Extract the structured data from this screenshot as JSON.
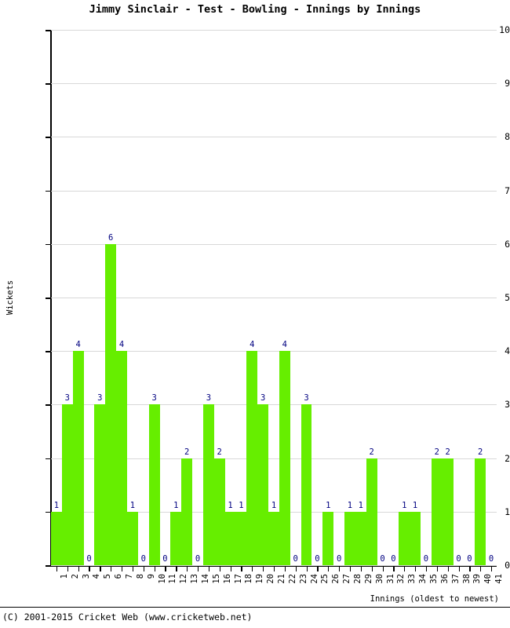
{
  "chart_data": {
    "type": "bar",
    "title": "Jimmy Sinclair - Test - Bowling - Innings by Innings",
    "xlabel": "Innings (oldest to newest)",
    "ylabel": "Wickets",
    "ylim": [
      0,
      10
    ],
    "ytick_labels": [
      "0",
      "1",
      "2",
      "3",
      "4",
      "5",
      "6",
      "7",
      "8",
      "9",
      "10"
    ],
    "grid": true,
    "legend": "none",
    "bar_color": "#66EE00",
    "label_color": "#000080",
    "categories": [
      "1",
      "2",
      "3",
      "4",
      "5",
      "6",
      "7",
      "8",
      "9",
      "10",
      "11",
      "12",
      "13",
      "14",
      "15",
      "16",
      "17",
      "18",
      "19",
      "20",
      "21",
      "22",
      "23",
      "24",
      "25",
      "26",
      "27",
      "28",
      "29",
      "30",
      "31",
      "32",
      "33",
      "34",
      "35",
      "36",
      "37",
      "38",
      "39",
      "40",
      "41"
    ],
    "values": [
      1,
      3,
      4,
      0,
      3,
      6,
      4,
      1,
      0,
      3,
      0,
      1,
      2,
      0,
      3,
      2,
      1,
      1,
      4,
      3,
      1,
      4,
      0,
      3,
      0,
      1,
      0,
      1,
      1,
      2,
      0,
      0,
      1,
      1,
      0,
      2,
      2,
      0,
      0,
      2,
      0
    ],
    "point_labels": [
      "1",
      "3",
      "4",
      "0",
      "3",
      "6",
      "4",
      "1",
      "0",
      "3",
      "0",
      "1",
      "2",
      "0",
      "3",
      "2",
      "1",
      "1",
      "4",
      "3",
      "1",
      "4",
      "0",
      "3",
      "0",
      "1",
      "0",
      "1",
      "1",
      "2",
      "0",
      "0",
      "1",
      "1",
      "0",
      "2",
      "2",
      "0",
      "0",
      "2",
      "0"
    ]
  },
  "footer": {
    "copyright": "(C) 2001-2015 Cricket Web (www.cricketweb.net)"
  }
}
